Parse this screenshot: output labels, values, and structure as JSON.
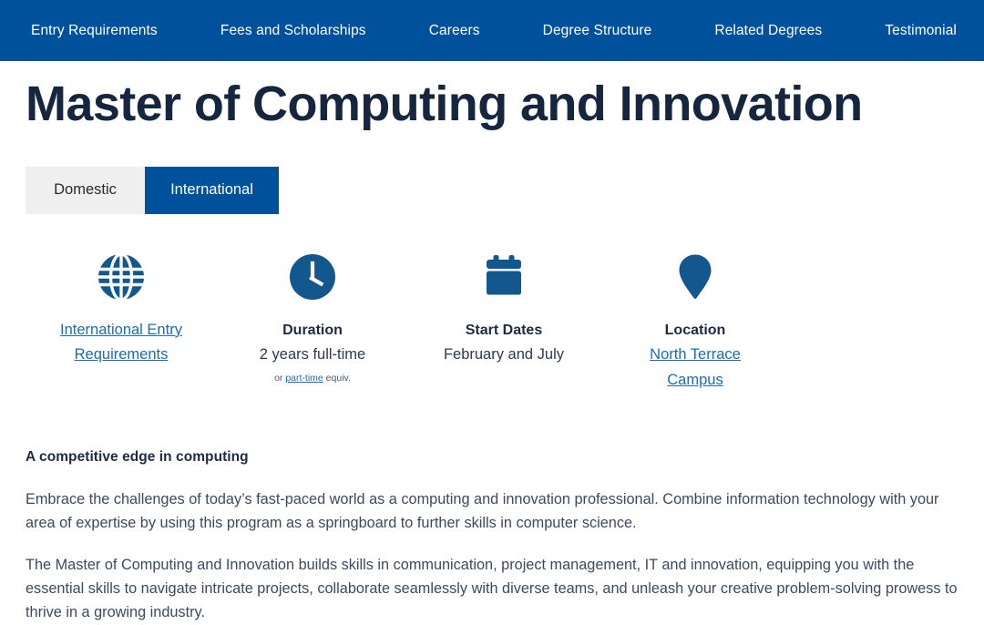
{
  "nav": {
    "items": [
      {
        "label": "Entry Requirements"
      },
      {
        "label": "Fees and Scholarships"
      },
      {
        "label": "Careers"
      },
      {
        "label": "Degree Structure"
      },
      {
        "label": "Related Degrees"
      },
      {
        "label": "Testimonial"
      }
    ]
  },
  "header": {
    "title": "Master of Computing and Innovation"
  },
  "tabs": [
    {
      "label": "Domestic",
      "active": false
    },
    {
      "label": "International",
      "active": true
    }
  ],
  "facts": [
    {
      "icon": "globe-icon",
      "label": "",
      "link_line1": "International Entry",
      "link_line2": "Requirements"
    },
    {
      "icon": "clock-icon",
      "label": "Duration",
      "value": "2 years full-time",
      "sub_prefix": "or ",
      "sub_link": "part-time",
      "sub_suffix": " equiv."
    },
    {
      "icon": "calendar-icon",
      "label": "Start Dates",
      "value": "February and July"
    },
    {
      "icon": "location-pin-icon",
      "label": "Location",
      "link_line1": "North Terrace",
      "link_line2": "Campus"
    }
  ],
  "main": {
    "heading": "A competitive edge in computing",
    "paragraph1": "Embrace the challenges of today’s fast-paced world as a computing and innovation professional. Combine information technology with your area of expertise by using this program as a springboard to further skills in computer science.",
    "paragraph2": "The Master of Computing and Innovation builds skills in communication, project management, IT and innovation, equipping you with the essential skills to navigate intricate projects, collaborate seamlessly with diverse teams, and unleash your creative problem-solving prowess to thrive in a growing industry."
  },
  "colors": {
    "brand_blue": "#00519c",
    "title_navy": "#17263f",
    "link_blue": "#1b6cb5",
    "tab_inactive_bg": "#efefef",
    "body_text": "#3c4a60"
  }
}
